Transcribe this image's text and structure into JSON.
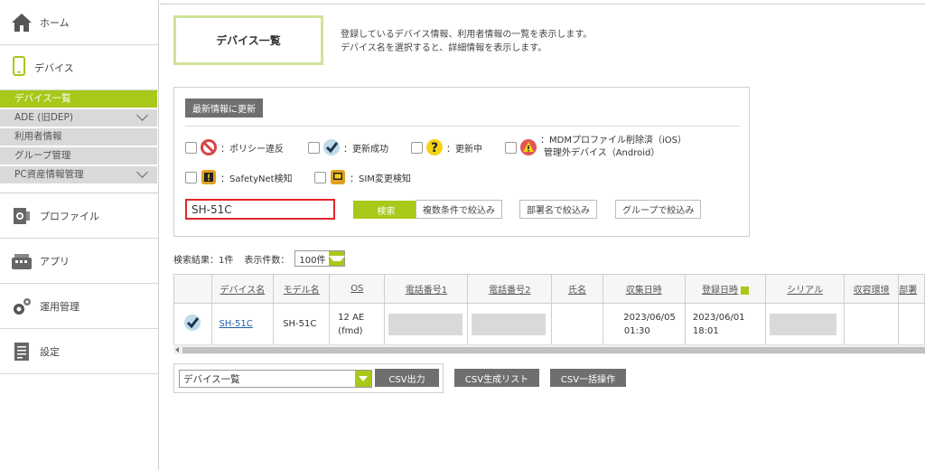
{
  "sidebar": {
    "home": "ホーム",
    "device": "デバイス",
    "sub": [
      {
        "label": "デバイス一覧",
        "active": true,
        "chevron": false
      },
      {
        "label": "ADE (旧DEP)",
        "active": false,
        "chevron": true
      },
      {
        "label": "利用者情報",
        "active": false,
        "chevron": false
      },
      {
        "label": "グループ管理",
        "active": false,
        "chevron": false
      },
      {
        "label": "PC資産情報管理",
        "active": false,
        "chevron": true
      }
    ],
    "profile": "プロファイル",
    "app": "アプリ",
    "ops": "運用管理",
    "settings": "設定"
  },
  "page": {
    "title": "デバイス一覧",
    "desc1": "登録しているデバイス情報、利用者情報の一覧を表示します。",
    "desc2": "デバイス名を選択すると、詳細情報を表示します。"
  },
  "filter": {
    "refresh": "最新情報に更新",
    "legend": {
      "policy": "：ポリシー違反",
      "success": "：更新成功",
      "updating": "：更新中",
      "mdm1": "：MDMプロファイル削除済（iOS）",
      "mdm2": "管理外デバイス（Android）",
      "safetynet": "：SafetyNet検知",
      "sim": "：SIM変更検知"
    },
    "search_value": "SH-51C",
    "search_btn": "検索",
    "multi": "複数条件で絞込み",
    "dept": "部署名で絞込み",
    "group": "グループで絞込み"
  },
  "results": {
    "label": "検索結果：1件",
    "count_label": "表示件数：",
    "count_value": "100件"
  },
  "table": {
    "headers": [
      "デバイス名",
      "モデル名",
      "OS",
      "電話番号1",
      "電話番号2",
      "氏名",
      "収集日時",
      "登録日時",
      "シリアル",
      "収容環境",
      "部署"
    ],
    "row": {
      "device": "SH-51C",
      "model": "SH-51C",
      "os1": "12 AE",
      "os2": "(fmd)",
      "collect1": "2023/06/05",
      "collect2": "01:30",
      "reg1": "2023/06/01",
      "reg2": "18:01"
    }
  },
  "export": {
    "select_value": "デバイス一覧",
    "csv_out": "CSV出力",
    "csv_list": "CSV生成リスト",
    "csv_bulk": "CSV一括操作"
  },
  "colors": {
    "accent": "#a8c81a",
    "title_border": "#cfe39a",
    "search_border": "#e2262b"
  }
}
